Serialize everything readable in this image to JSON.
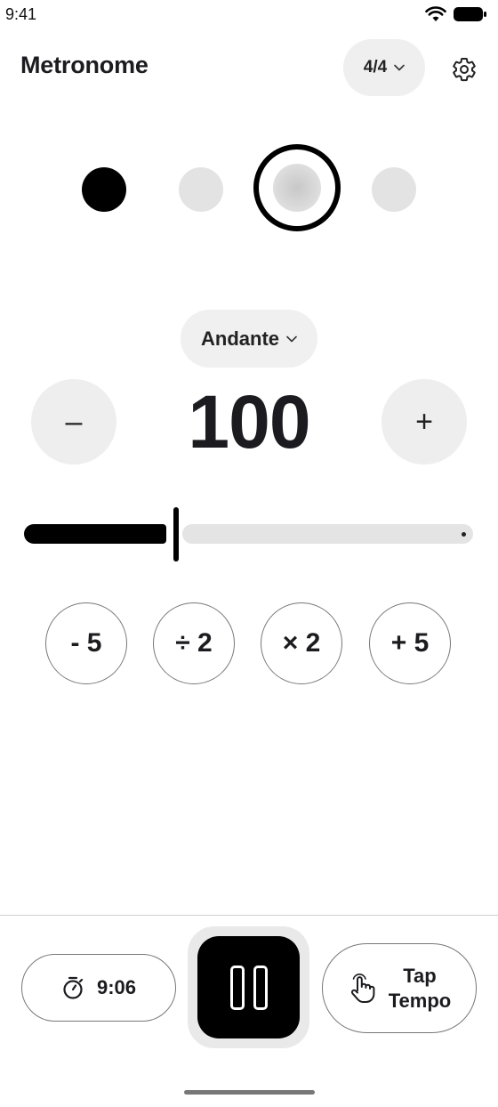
{
  "status_bar": {
    "time": "9:41",
    "icons": [
      "wifi-icon",
      "battery-icon"
    ]
  },
  "app_bar": {
    "title": "Metronome",
    "time_signature": "4/4",
    "settings_icon": "gear-icon"
  },
  "beats": {
    "count": 4,
    "states": [
      "accent",
      "normal",
      "current",
      "normal"
    ]
  },
  "tempo": {
    "name": "Andante",
    "bpm": "100",
    "decrement_label": "–",
    "increment_label": "+",
    "slider_fraction": 0.34
  },
  "quick_actions": [
    "- 5",
    "÷ 2",
    "× 2",
    "+ 5"
  ],
  "bottom": {
    "timer_label": "9:06",
    "timer_icon": "stopwatch-icon",
    "playback_state": "playing",
    "pause_icon": "pause-icon",
    "tap_label_line1": "Tap",
    "tap_label_line2": "Tempo",
    "tap_icon": "hand-pointer-icon"
  },
  "colors": {
    "accent": "#000000",
    "surface": "#eeeeee",
    "outline": "#777777"
  }
}
